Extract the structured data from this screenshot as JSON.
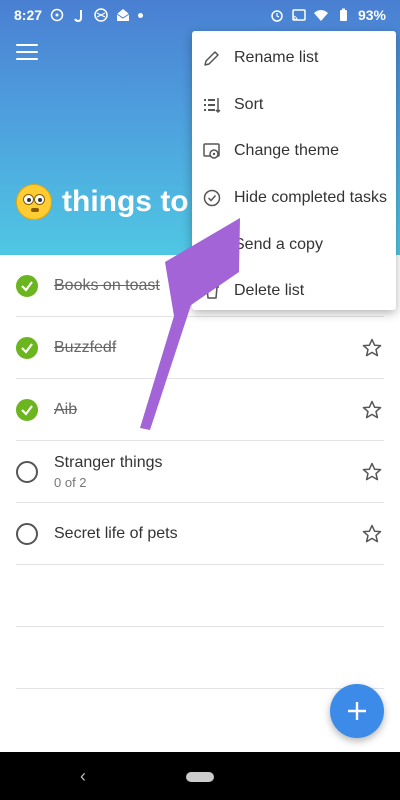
{
  "status_bar": {
    "time": "8:27",
    "left_icons": [
      "whatsapp-icon",
      "j-app-icon",
      "settings-app-icon",
      "mail-icon",
      "dot-icon"
    ],
    "right_icons": [
      "alarm-icon",
      "cast-icon",
      "wifi-icon",
      "battery-icon"
    ],
    "battery": "93%"
  },
  "header": {
    "title": "things to",
    "emoji": "flushed-face-emoji",
    "gradient": [
      "#4a7fd2",
      "#4fc7e3"
    ]
  },
  "menu": {
    "items": [
      {
        "label": "Rename list",
        "icon": "pencil-icon"
      },
      {
        "label": "Sort",
        "icon": "sort-icon"
      },
      {
        "label": "Change theme",
        "icon": "theme-icon"
      },
      {
        "label": "Hide completed tasks",
        "icon": "check-circle-icon"
      },
      {
        "label": "Send a copy",
        "icon": "share-icon"
      },
      {
        "label": "Delete list",
        "icon": "trash-icon"
      }
    ]
  },
  "tasks": [
    {
      "title": "Books on toast",
      "completed": true,
      "sub": ""
    },
    {
      "title": "Buzzfedf",
      "completed": true,
      "sub": ""
    },
    {
      "title": "Aib",
      "completed": true,
      "sub": ""
    },
    {
      "title": "Stranger things",
      "completed": false,
      "sub": "0 of 2"
    },
    {
      "title": "Secret life of pets",
      "completed": false,
      "sub": ""
    }
  ],
  "colors": {
    "accent": "#3d8be8",
    "complete": "#6bb51f",
    "annotation_arrow": "#a264d6"
  },
  "fab_icon": "plus-icon",
  "nav": {
    "back_icon": "back-chevron-icon",
    "home_icon": "home-pill-icon"
  }
}
